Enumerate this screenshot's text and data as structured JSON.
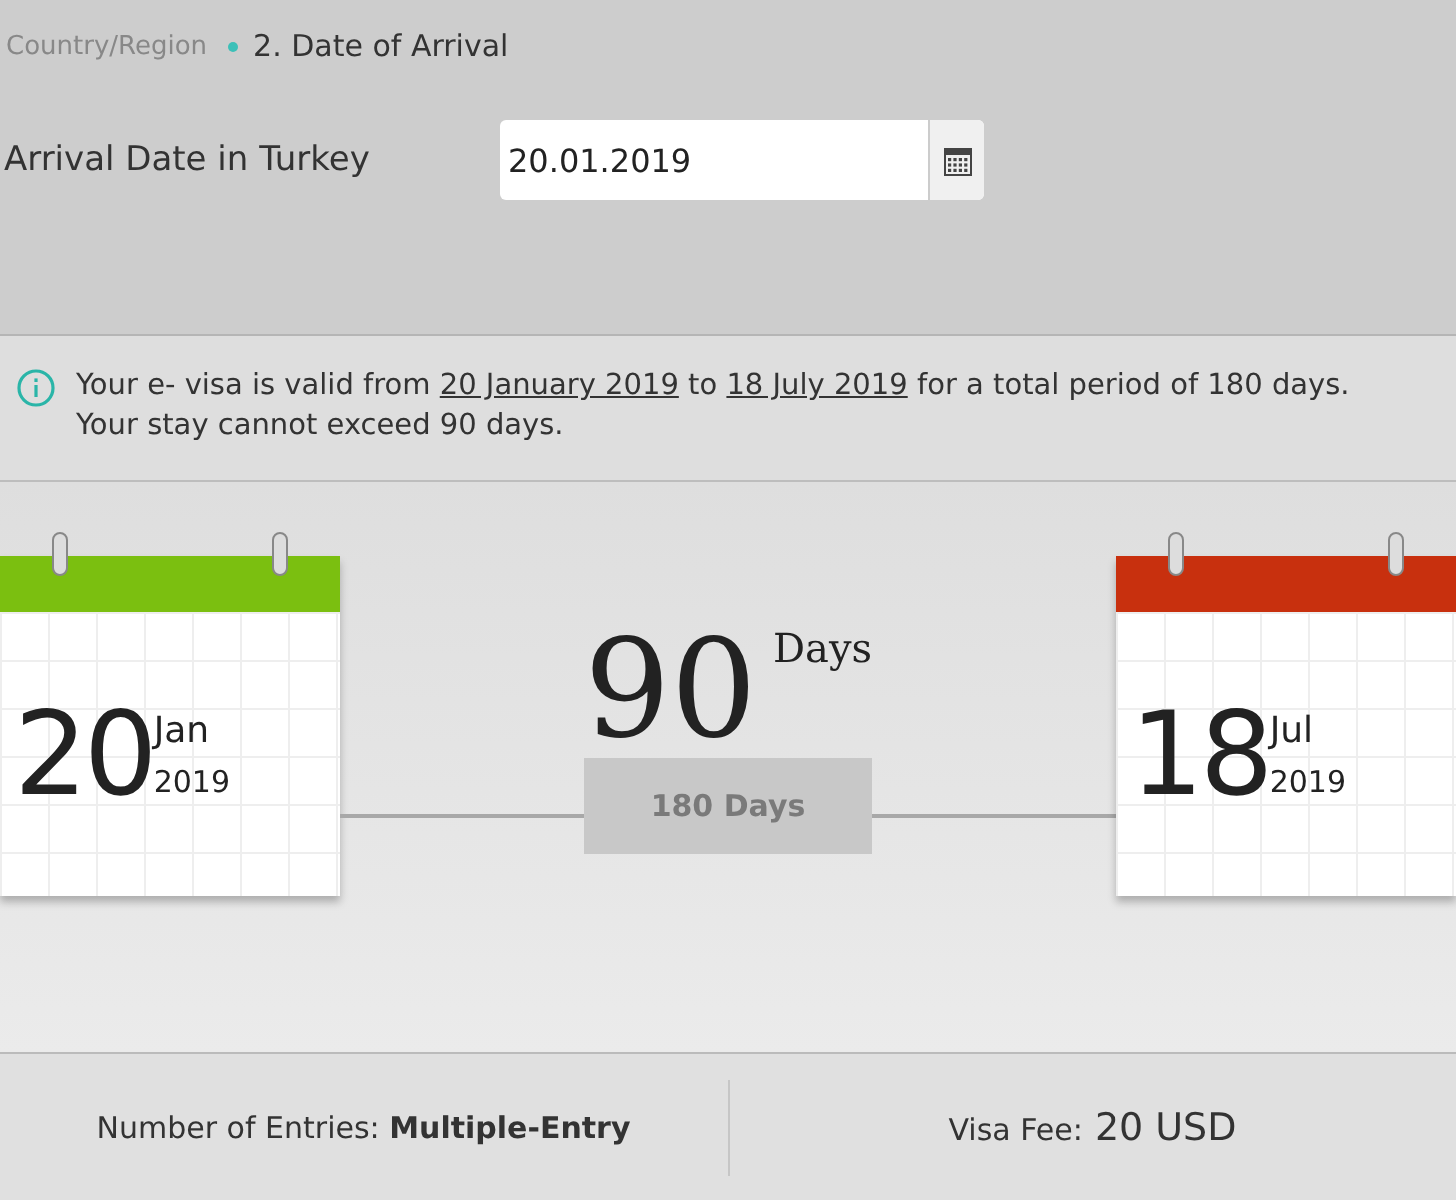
{
  "breadcrumb": [
    {
      "label": "Country/Region",
      "selected": false
    },
    {
      "label": "2. Date of Arrival",
      "selected": true
    }
  ],
  "arrival": {
    "label": "Arrival Date in Turkey",
    "value": "20.01.2019"
  },
  "info": {
    "parts": [
      {
        "kind": "text",
        "text": "Your e- visa is valid from "
      },
      {
        "kind": "link",
        "text": "20 January 2019"
      },
      {
        "kind": "text",
        "text": " to "
      },
      {
        "kind": "link",
        "text": "18 July 2019"
      },
      {
        "kind": "text",
        "text": " for a total period of 180 days. Your stay cannot exceed 90 days."
      }
    ]
  },
  "calendars": [
    {
      "day": "20",
      "month": "Jan",
      "year": "2019",
      "color": "#7bbf10"
    },
    {
      "day": "18",
      "month": "Jul",
      "year": "2019",
      "color": "#c8300e"
    }
  ],
  "stay": {
    "number": "90",
    "unit": "Days",
    "period": "180 Days"
  },
  "summary": {
    "entries": "Number of Entries: **Multiple-Entry**",
    "fee_label": "Visa Fee:",
    "fee_value": "20 USD"
  }
}
